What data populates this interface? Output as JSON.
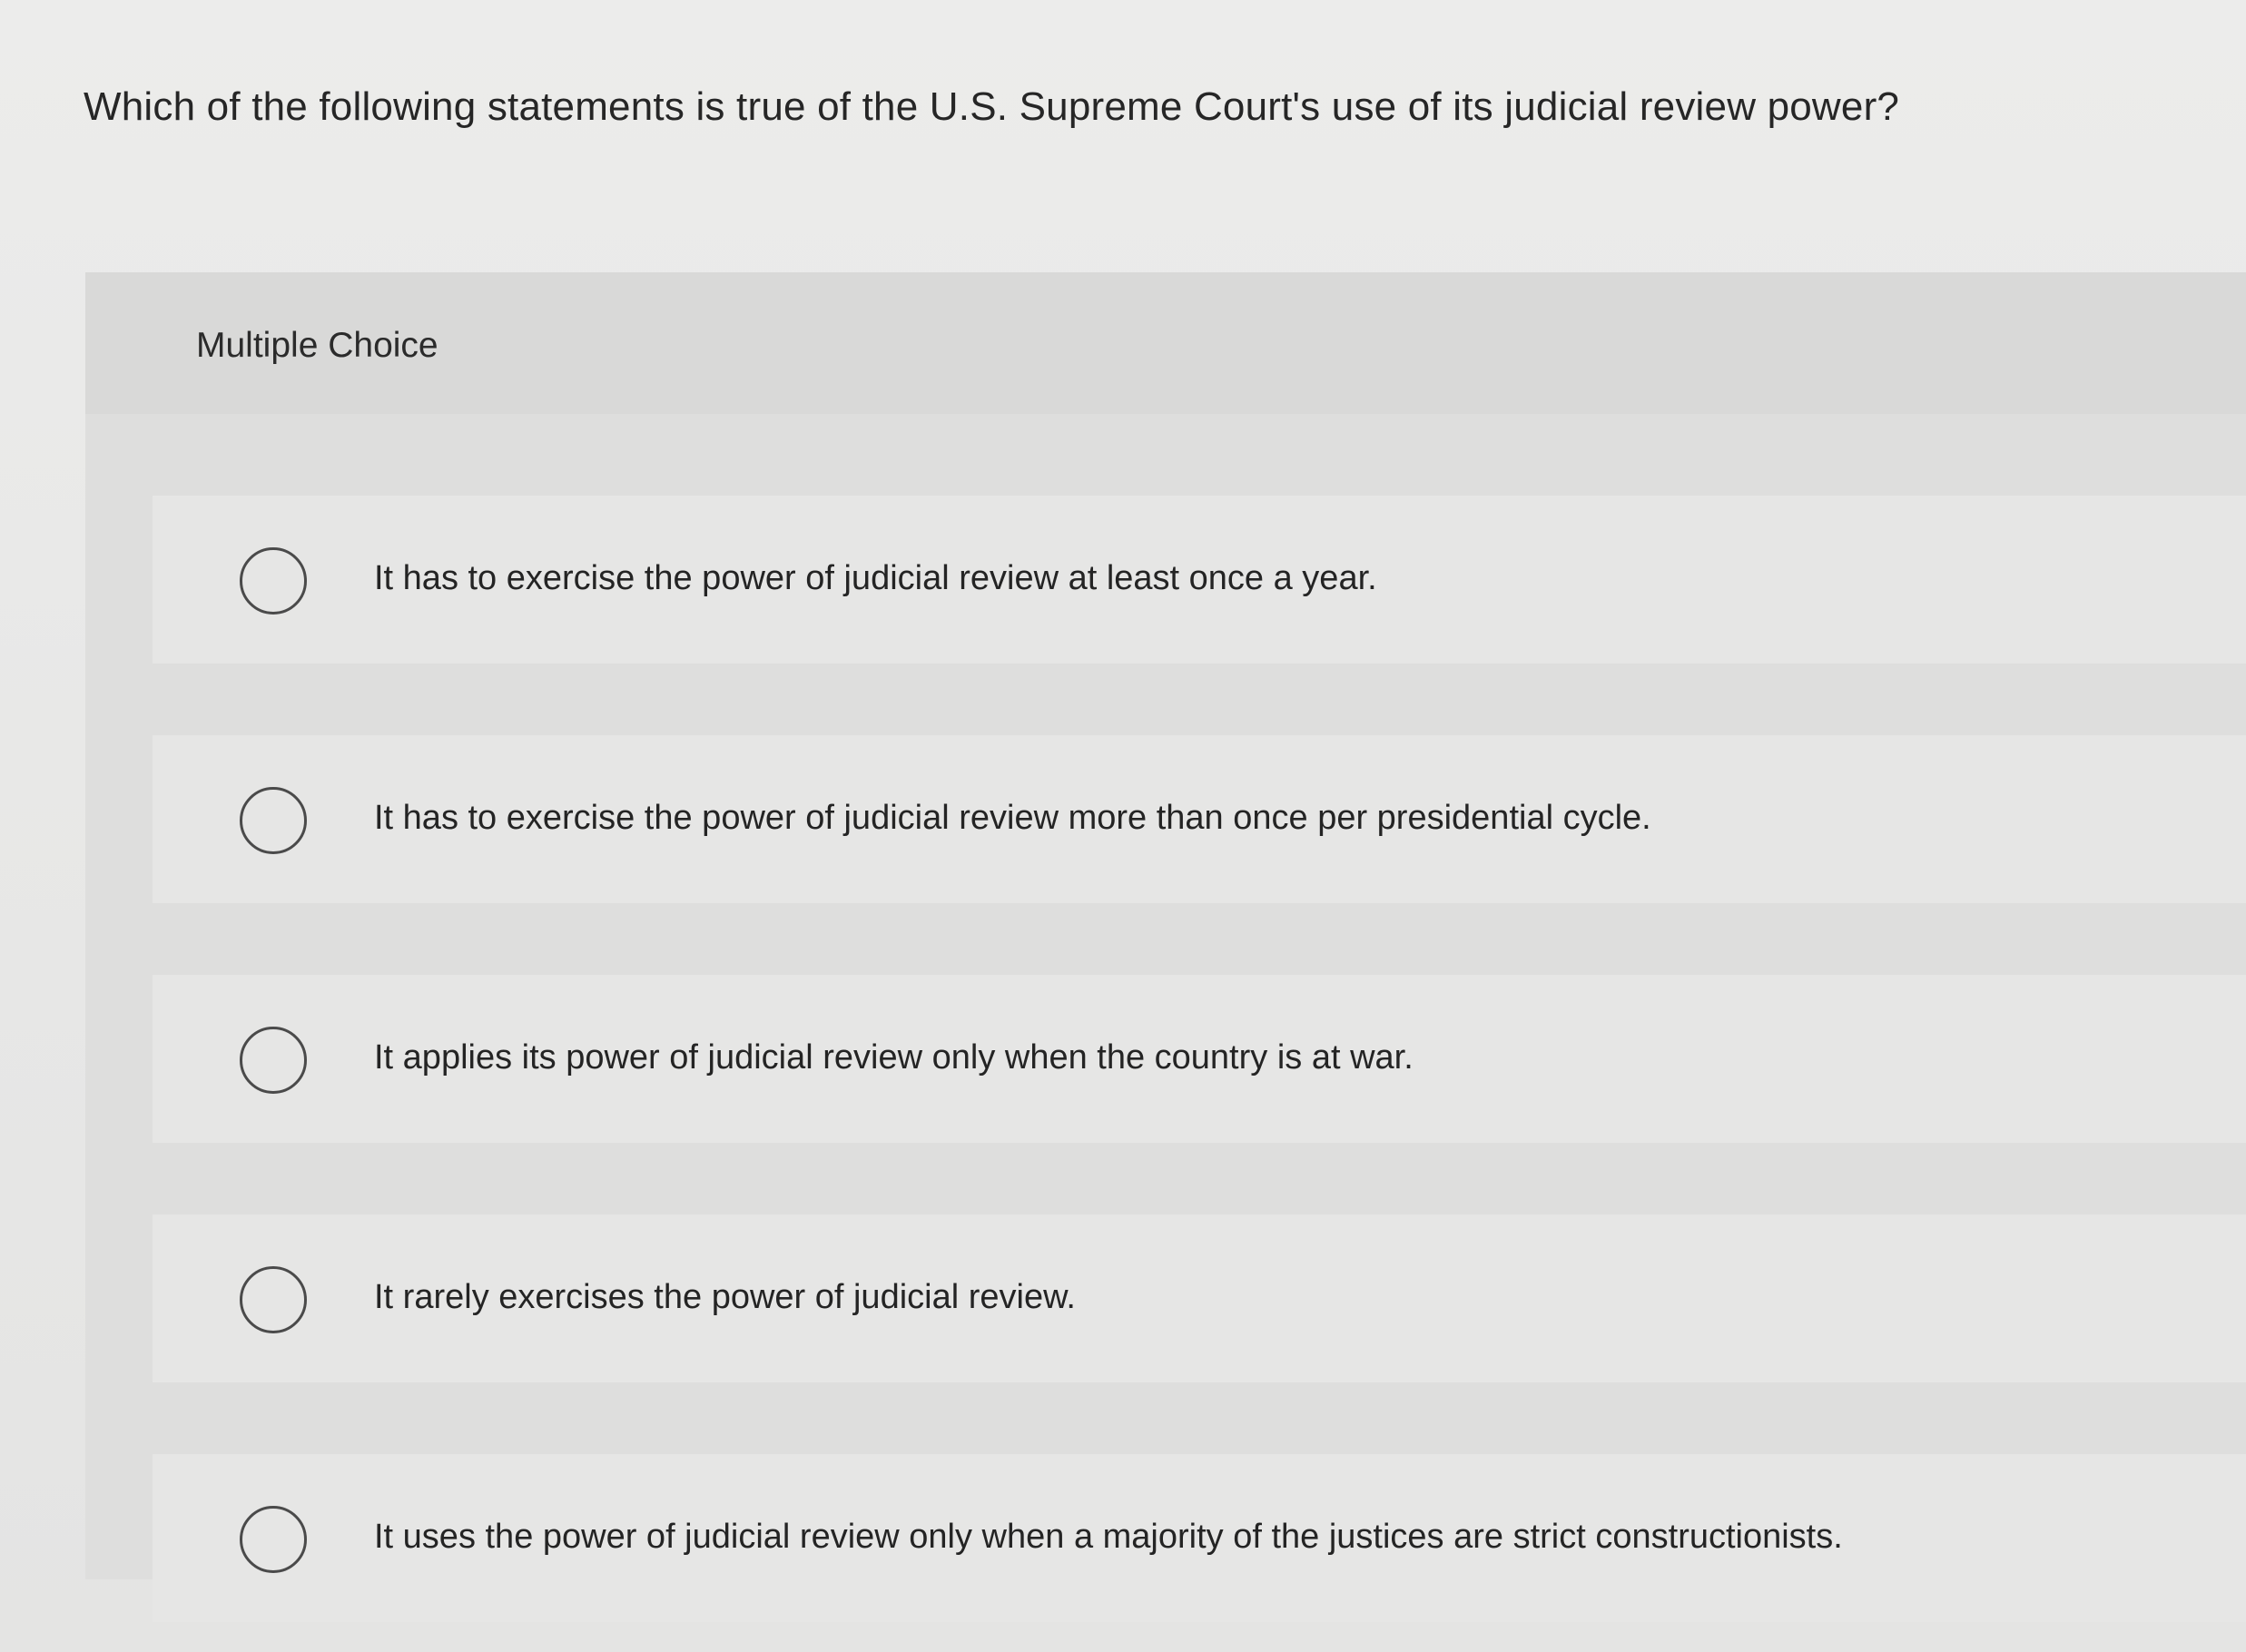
{
  "question": {
    "text": "Which of the following statements is true of the U.S. Supreme Court's use of its judicial review power?"
  },
  "multiple_choice": {
    "label": "Multiple Choice",
    "options": [
      {
        "text": "It has to exercise the power of judicial review at least once a year.",
        "selected": false
      },
      {
        "text": "It has to exercise the power of judicial review more than once per presidential cycle.",
        "selected": false
      },
      {
        "text": "It applies its power of judicial review only when the country is at war.",
        "selected": false
      },
      {
        "text": "It rarely exercises the power of judicial review.",
        "selected": false
      },
      {
        "text": "It uses the power of judicial review only when a majority of the justices are strict constructionists.",
        "selected": false
      }
    ]
  },
  "colors": {
    "page_background": "#e7e7e6",
    "panel_background": "#dededd",
    "option_background": "#e6e6e5",
    "text": "#242424",
    "radio_border": "#4a4a4a"
  },
  "icons": {
    "option_marker": "radio-circle-icon"
  }
}
